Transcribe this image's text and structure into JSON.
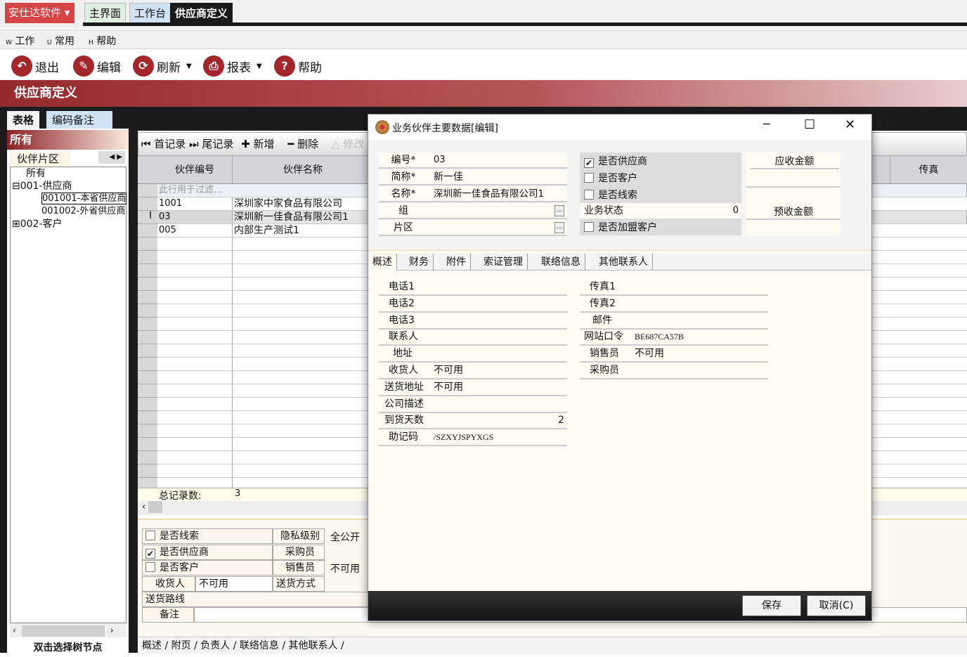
{
  "app": {
    "brand": "安仕达软件",
    "tabs": [
      "主界面",
      "工作台",
      "供应商定义"
    ]
  },
  "menu": [
    {
      "key": "W",
      "label": "工作"
    },
    {
      "key": "U",
      "label": "常用"
    },
    {
      "key": "H",
      "label": "帮助"
    }
  ],
  "toolbar": [
    {
      "label": "退出",
      "icon": "exit-icon"
    },
    {
      "label": "编辑",
      "icon": "edit-icon"
    },
    {
      "label": "刷新",
      "icon": "refresh-icon"
    },
    {
      "label": "报表",
      "icon": "print-icon"
    },
    {
      "label": "帮助",
      "icon": "help-icon"
    }
  ],
  "page_title": "供应商定义",
  "view_tabs": [
    "表格",
    "编码备注"
  ],
  "left": {
    "header": "所有",
    "tab": "伙伴片区",
    "tree": [
      "所有",
      "001-供应商",
      "001001-本省供应商",
      "001002-外省供应商",
      "002-客户"
    ],
    "footer": "双击选择树节点"
  },
  "nav": [
    "首记录",
    "尾记录",
    "新增",
    "删除",
    "修改"
  ],
  "grid": {
    "columns": [
      "伙伴编号",
      "伙伴名称",
      "传真"
    ],
    "filter_hint": "此行用于过滤...",
    "rows": [
      [
        "1001",
        "深圳家中家食品有限公司"
      ],
      [
        "03",
        "深圳新一佳食品有限公司1"
      ],
      [
        "005",
        "内部生产测试1"
      ]
    ],
    "total_label": "总记录数:",
    "total": "3"
  },
  "bottom_form": {
    "c1": "是否线索",
    "c2": "是否供应商",
    "c3": "是否客户",
    "privacy_label": "隐私级别",
    "privacy": "全公开",
    "buyer_label": "采购员",
    "seller_label": "销售员",
    "seller": "不可用",
    "receiver_label": "收货人",
    "receiver": "不可用",
    "ship_method_label": "送货方式",
    "route_label": "送货路线",
    "note_label": "备注"
  },
  "bottom_tabs": [
    "概述",
    "附页",
    "负责人",
    "联络信息",
    "其他联系人"
  ],
  "dialog": {
    "title": "业务伙伴主要数据[编辑]",
    "fields": [
      {
        "label": "编号*",
        "value": "03"
      },
      {
        "label": "简称*",
        "value": "新一佳"
      },
      {
        "label": "名称*",
        "value": "深圳新一佳食品有限公司1"
      },
      {
        "label": "组",
        "value": ""
      },
      {
        "label": "片区",
        "value": ""
      }
    ],
    "checks": [
      {
        "label": "是否供应商",
        "checked": true
      },
      {
        "label": "是否客户",
        "checked": false
      },
      {
        "label": "是否线索",
        "checked": false
      }
    ],
    "status_label": "业务状态",
    "status": "0",
    "franchise_label": "是否加盟客户",
    "receivable_label": "应收金额",
    "prepaid_label": "预收金额",
    "tabs": [
      "概述",
      "财务",
      "附件",
      "索证管理",
      "联络信息",
      "其他联系人"
    ],
    "left_rows": [
      {
        "label": "电话1",
        "value": ""
      },
      {
        "label": "电话2",
        "value": ""
      },
      {
        "label": "电话3",
        "value": ""
      },
      {
        "label": "联系人",
        "value": ""
      },
      {
        "label": "地址",
        "value": ""
      },
      {
        "label": "收货人",
        "value": "不可用"
      },
      {
        "label": "送货地址",
        "value": "不可用"
      },
      {
        "label": "公司描述",
        "value": ""
      },
      {
        "label": "到货天数",
        "value": "2"
      },
      {
        "label": "助记码",
        "value": "/SZXYJSPYXGS"
      }
    ],
    "right_rows": [
      {
        "label": "传真1",
        "value": ""
      },
      {
        "label": "传真2",
        "value": ""
      },
      {
        "label": "邮件",
        "value": ""
      },
      {
        "label": "网站口令",
        "value": "BE687CA57B"
      },
      {
        "label": "销售员",
        "value": "不可用"
      },
      {
        "label": "采购员",
        "value": ""
      }
    ],
    "save": "保存",
    "cancel": "取消(C)"
  }
}
